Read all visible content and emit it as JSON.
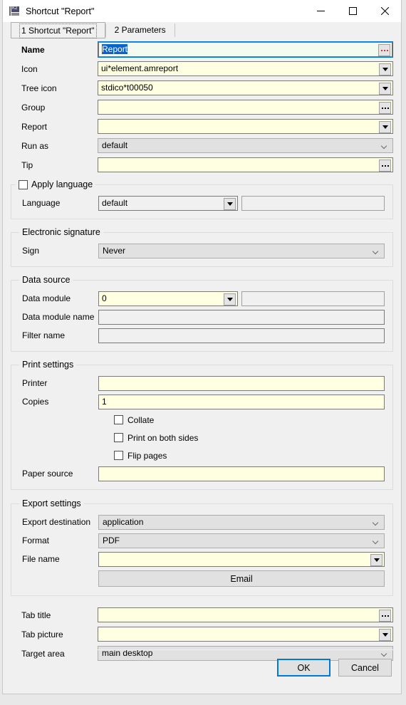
{
  "window": {
    "title": "Shortcut \"Report\"",
    "icon": "app-icon",
    "minimize": "minimize-icon",
    "maximize": "maximize-icon",
    "close": "close-icon"
  },
  "tabs": [
    {
      "label": "1 Shortcut \"Report\"",
      "active": true
    },
    {
      "label": "2 Parameters",
      "active": false
    }
  ],
  "fields": {
    "name": {
      "label": "Name",
      "value": "Report",
      "button": "ellipsis-red"
    },
    "icon": {
      "label": "Icon",
      "value": "ui*element.amreport",
      "button": "dropdown"
    },
    "tree_icon": {
      "label": "Tree icon",
      "value": "stdico*t00050",
      "button": "dropdown"
    },
    "group": {
      "label": "Group",
      "value": "",
      "button": "ellipsis"
    },
    "report": {
      "label": "Report",
      "value": "",
      "button": "dropdown"
    },
    "run_as": {
      "label": "Run as",
      "value": "default"
    },
    "tip": {
      "label": "Tip",
      "value": "",
      "button": "ellipsis"
    }
  },
  "apply_language": {
    "title": "Apply language",
    "checked": false,
    "language": {
      "label": "Language",
      "value": "default",
      "extra": ""
    }
  },
  "electronic_signature": {
    "title": "Electronic signature",
    "sign": {
      "label": "Sign",
      "value": "Never"
    }
  },
  "data_source": {
    "title": "Data source",
    "data_module": {
      "label": "Data module",
      "value": "0",
      "extra": ""
    },
    "data_module_name": {
      "label": "Data module name",
      "value": ""
    },
    "filter_name": {
      "label": "Filter name",
      "value": ""
    }
  },
  "print_settings": {
    "title": "Print settings",
    "printer": {
      "label": "Printer",
      "value": ""
    },
    "copies": {
      "label": "Copies",
      "value": "1"
    },
    "collate": {
      "label": "Collate",
      "checked": false
    },
    "both_sides": {
      "label": "Print on both sides",
      "checked": false
    },
    "flip_pages": {
      "label": "Flip pages",
      "checked": false
    },
    "paper_source": {
      "label": "Paper source",
      "value": ""
    }
  },
  "export_settings": {
    "title": "Export settings",
    "destination": {
      "label": "Export destination",
      "value": "application"
    },
    "format": {
      "label": "Format",
      "value": "PDF"
    },
    "file_name": {
      "label": "File name",
      "value": ""
    },
    "email_button": "Email"
  },
  "bottom_fields": {
    "tab_title": {
      "label": "Tab title",
      "value": ""
    },
    "tab_picture": {
      "label": "Tab picture",
      "value": ""
    },
    "target_area": {
      "label": "Target area",
      "value": "main desktop"
    }
  },
  "footer": {
    "ok": "OK",
    "cancel": "Cancel"
  },
  "colors": {
    "accent": "#0078d7",
    "editable_field": "#ffffe1",
    "readonly_field": "#f0f0f0",
    "selection": "#0a64c8",
    "ellipsis_red": "#e03030"
  }
}
